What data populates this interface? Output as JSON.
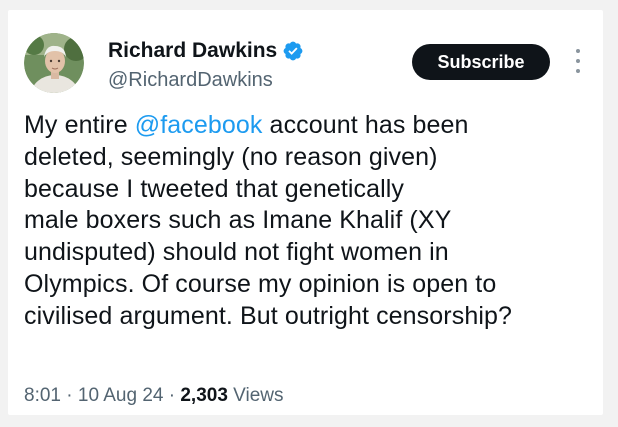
{
  "author": {
    "name": "Richard Dawkins",
    "handle": "@RichardDawkins",
    "verified": true,
    "avatar_icon": "profile-photo"
  },
  "actions": {
    "subscribe_label": "Subscribe",
    "more_icon": "vertical-ellipsis-icon"
  },
  "tweet": {
    "text_before": "My entire ",
    "mention": "@facebook",
    "text_after": " account has been\ndeleted, seemingly (no reason given)\nbecause I tweeted that genetically\nmale boxers such as Imane Khalif (XY\nundisputed) should not fight women in\nOlympics. Of course  my opinion is open to\ncivilised argument. But outright censorship?"
  },
  "meta": {
    "time": "8:01",
    "sep1": " · ",
    "date": "10 Aug 24",
    "sep2": " · ",
    "views_count": "2,303",
    "views_label": " Views"
  },
  "colors": {
    "link": "#1d9bf0",
    "verified_badge": "#1d9bf0",
    "text": "#0f1419",
    "secondary": "#536471"
  }
}
